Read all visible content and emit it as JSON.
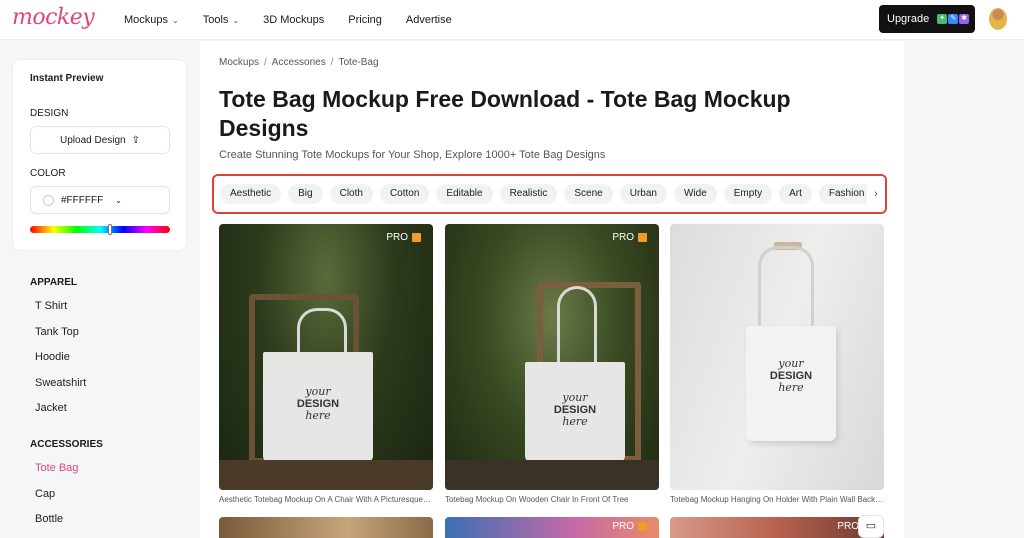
{
  "brand": {
    "logo_text": "mockey",
    "accent": "#e2457d"
  },
  "nav": {
    "items": [
      {
        "label": "Mockups",
        "has_dropdown": true
      },
      {
        "label": "Tools",
        "has_dropdown": true
      },
      {
        "label": "3D Mockups",
        "has_dropdown": false
      },
      {
        "label": "Pricing",
        "has_dropdown": false
      },
      {
        "label": "Advertise",
        "has_dropdown": false
      }
    ],
    "upgrade_label": "Upgrade"
  },
  "preview": {
    "title": "Instant Preview",
    "design_label": "DESIGN",
    "upload_label": "Upload Design",
    "color_label": "COLOR",
    "color_value": "#FFFFFF"
  },
  "categories": {
    "apparel_heading": "APPAREL",
    "apparel": [
      "T Shirt",
      "Tank Top",
      "Hoodie",
      "Sweatshirt",
      "Jacket"
    ],
    "accessories_heading": "ACCESSORIES",
    "accessories": [
      "Tote Bag",
      "Cap",
      "Bottle"
    ],
    "active": "Tote Bag"
  },
  "breadcrumb": [
    "Mockups",
    "Accessories",
    "Tote-Bag"
  ],
  "page": {
    "title": "Tote Bag Mockup Free Download - Tote Bag Mockup Designs",
    "subtitle": "Create Stunning Tote Mockups for Your Shop, Explore 1000+ Tote Bag Designs"
  },
  "tags": [
    "Aesthetic",
    "Big",
    "Cloth",
    "Cotton",
    "Editable",
    "Realistic",
    "Scene",
    "Urban",
    "Wide",
    "Empty",
    "Art",
    "Fashion"
  ],
  "mockups": [
    {
      "pro_label": "PRO",
      "caption": "Aesthetic Totebag Mockup On A Chair With A Picturesque Background",
      "bag_text_1": "your",
      "bag_text_2": "DESIGN",
      "bag_text_3": "here"
    },
    {
      "pro_label": "PRO",
      "caption": "Totebag Mockup On Wooden Chair In Front Of Tree",
      "bag_text_1": "your",
      "bag_text_2": "DESIGN",
      "bag_text_3": "here"
    },
    {
      "pro_label": "",
      "caption": "Totebag Mockup Hanging On Holder With Plain Wall Background",
      "bag_text_1": "your",
      "bag_text_2": "DESIGN",
      "bag_text_3": "here"
    }
  ],
  "row2": [
    {
      "pro_label": ""
    },
    {
      "pro_label": "PRO"
    },
    {
      "pro_label": "PRO"
    }
  ]
}
